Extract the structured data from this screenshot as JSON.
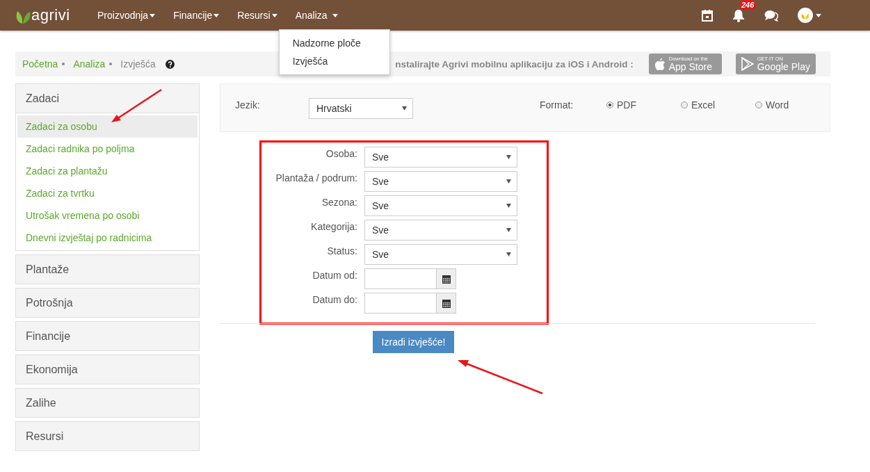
{
  "navbar": {
    "logo": "agrivi",
    "items": [
      {
        "label": "Proizvodnja",
        "expanded": false
      },
      {
        "label": "Financije",
        "expanded": false
      },
      {
        "label": "Resursi",
        "expanded": false
      },
      {
        "label": "Analiza",
        "expanded": true,
        "menu": [
          "Nadzorne ploče",
          "Izvješća"
        ]
      }
    ],
    "notification_count": "246"
  },
  "breadcrumb": [
    {
      "label": "Početna",
      "link": true
    },
    {
      "label": "Analiza",
      "link": true
    },
    {
      "label": "Izvješća",
      "link": false
    }
  ],
  "app_banner": {
    "text": "nstalirajte Agrivi mobilnu aplikaciju za iOS i Android :",
    "stores": [
      {
        "kind": "apple",
        "small": "Download on the",
        "big": "App Store"
      },
      {
        "kind": "google",
        "small": "GET IT ON",
        "big": "Google Play"
      }
    ]
  },
  "sidebar": [
    {
      "title": "Zadaci",
      "items": [
        {
          "label": "Zadaci za osobu",
          "selected": true
        },
        {
          "label": "Zadaci radnika po poljma",
          "selected": false
        },
        {
          "label": "Zadaci za plantažu",
          "selected": false
        },
        {
          "label": "Zadaci za tvrtku",
          "selected": false
        },
        {
          "label": "Utrošak vremena po osobi",
          "selected": false
        },
        {
          "label": "Dnevni izvještaj po radnicima",
          "selected": false
        }
      ]
    },
    {
      "title": "Plantaže"
    },
    {
      "title": "Potrošnja"
    },
    {
      "title": "Financije"
    },
    {
      "title": "Ekonomija"
    },
    {
      "title": "Zalihe"
    },
    {
      "title": "Resursi"
    }
  ],
  "options": {
    "language_label": "Jezik:",
    "language": "Hrvatski",
    "format_label": "Format:",
    "formats": [
      {
        "label": "PDF",
        "selected": true
      },
      {
        "label": "Excel",
        "selected": false
      },
      {
        "label": "Word",
        "selected": false
      }
    ]
  },
  "filters": [
    {
      "kind": "select",
      "label": "Osoba:",
      "value": "Sve"
    },
    {
      "kind": "select",
      "label": "Plantaža / podrum:",
      "value": "Sve"
    },
    {
      "kind": "select",
      "label": "Sezona:",
      "value": "Sve"
    },
    {
      "kind": "select",
      "label": "Kategorija:",
      "value": "Sve"
    },
    {
      "kind": "select",
      "label": "Status:",
      "value": "Sve"
    },
    {
      "kind": "date",
      "label": "Datum od:"
    },
    {
      "kind": "date",
      "label": "Datum do:"
    }
  ],
  "submit": "Izradi izvješće!"
}
